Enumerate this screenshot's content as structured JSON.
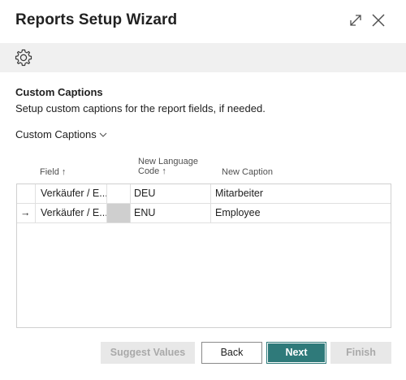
{
  "window": {
    "title": "Reports Setup Wizard"
  },
  "section": {
    "title": "Custom Captions",
    "description": "Setup custom captions for the report fields, if needed."
  },
  "subpage": {
    "title": "Custom Captions"
  },
  "table": {
    "columns": {
      "field": "Field ↑",
      "language_line1": "New Language",
      "language_line2": "Code ↑",
      "caption": "New Caption"
    },
    "rows": [
      {
        "selector": "",
        "field": "Verkäufer / E...",
        "language": "DEU",
        "caption": "Mitarbeiter"
      },
      {
        "selector": "→",
        "field": "Verkäufer / E...",
        "language": "ENU",
        "caption": "Employee"
      }
    ]
  },
  "buttons": {
    "suggest": "Suggest Values",
    "back": "Back",
    "next": "Next",
    "finish": "Finish"
  },
  "colors": {
    "primary": "#2f7a7a",
    "action_bar": "#f0f0f0",
    "disabled_bg": "#e8e8e8",
    "disabled_text": "#a9a9a9"
  },
  "icons": {
    "expand": "expand-icon",
    "close": "close-icon",
    "settings": "gear-icon",
    "dropdown": "chevron-down-icon",
    "current_row": "arrow-right-icon"
  }
}
